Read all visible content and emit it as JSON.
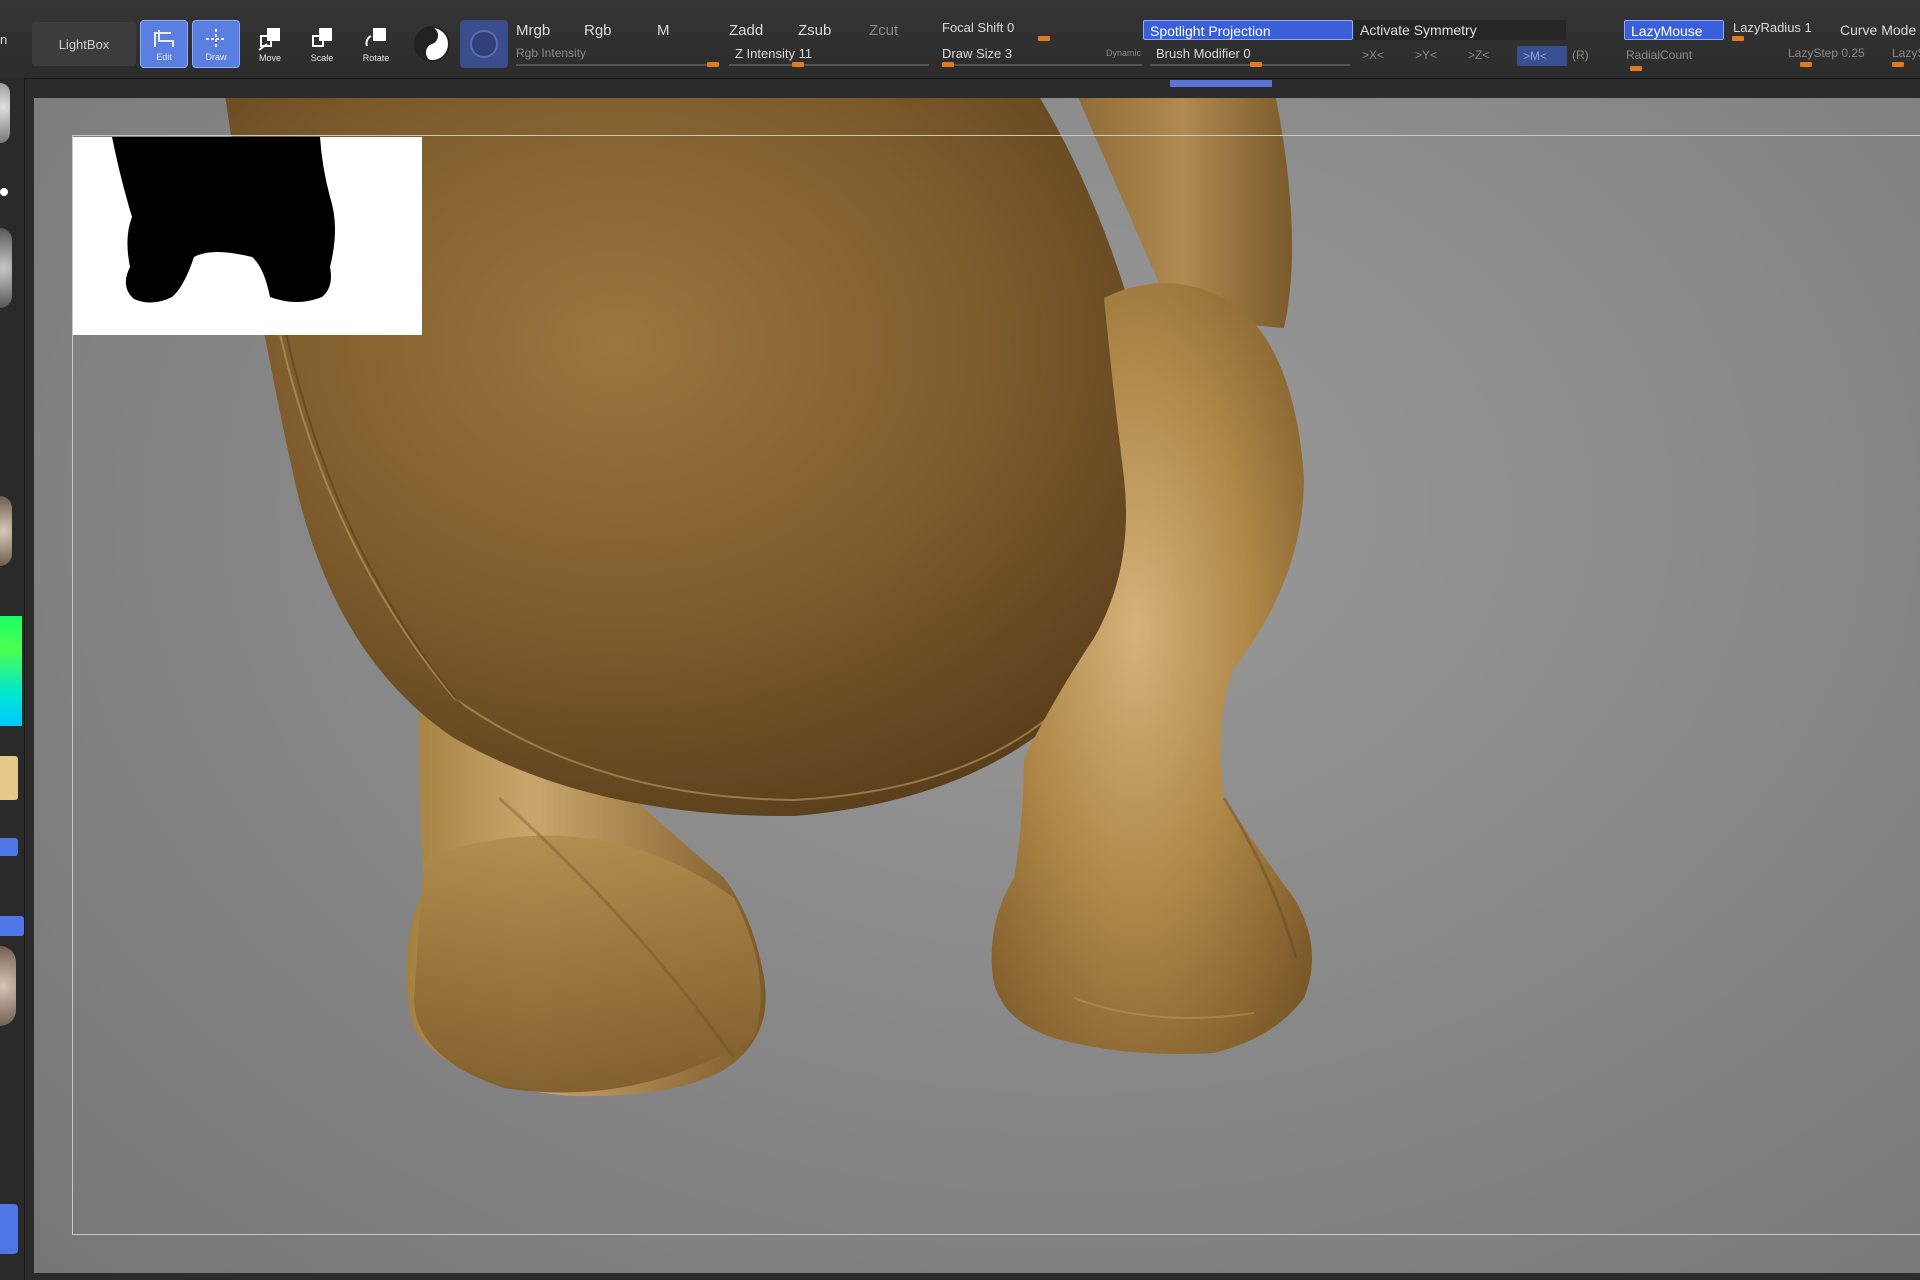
{
  "toolbar": {
    "lightbox_label": "LightBox",
    "tools": [
      {
        "name": "edit",
        "label": "Edit",
        "active": true
      },
      {
        "name": "draw",
        "label": "Draw",
        "active": true
      },
      {
        "name": "move",
        "label": "Move",
        "active": false
      },
      {
        "name": "scale",
        "label": "Scale",
        "active": false
      },
      {
        "name": "rotate",
        "label": "Rotate",
        "active": false
      }
    ],
    "mrgb": "Mrgb",
    "rgb": "Rgb",
    "m": "M",
    "rgb_intensity": "Rgb Intensity",
    "zadd": "Zadd",
    "zsub": "Zsub",
    "zcut": "Zcut",
    "z_intensity": "Z Intensity 11",
    "focal_shift": "Focal Shift 0",
    "draw_size": "Draw Size 3",
    "dynamic": "Dynamic",
    "spotlight_projection": "Spotlight Projection",
    "brush_modifier": "Brush Modifier 0",
    "activate_symmetry": "Activate Symmetry",
    "sym_x": ">X<",
    "sym_y": ">Y<",
    "sym_z": ">Z<",
    "sym_m": ">M<",
    "sym_r": "(R)",
    "radial_count": "RadialCount",
    "lazymouse": "LazyMouse",
    "lazyradius": "LazyRadius 1",
    "lazystep": "LazyStep 0.25",
    "lazysnap": "LazySnap",
    "curve_mode": "Curve Mode"
  },
  "colors": {
    "accent_blue": "#5b7fe0",
    "slider_orange": "#e07a1f",
    "model_gold": "#a0783e",
    "background_gray": "#8a8a8a"
  }
}
